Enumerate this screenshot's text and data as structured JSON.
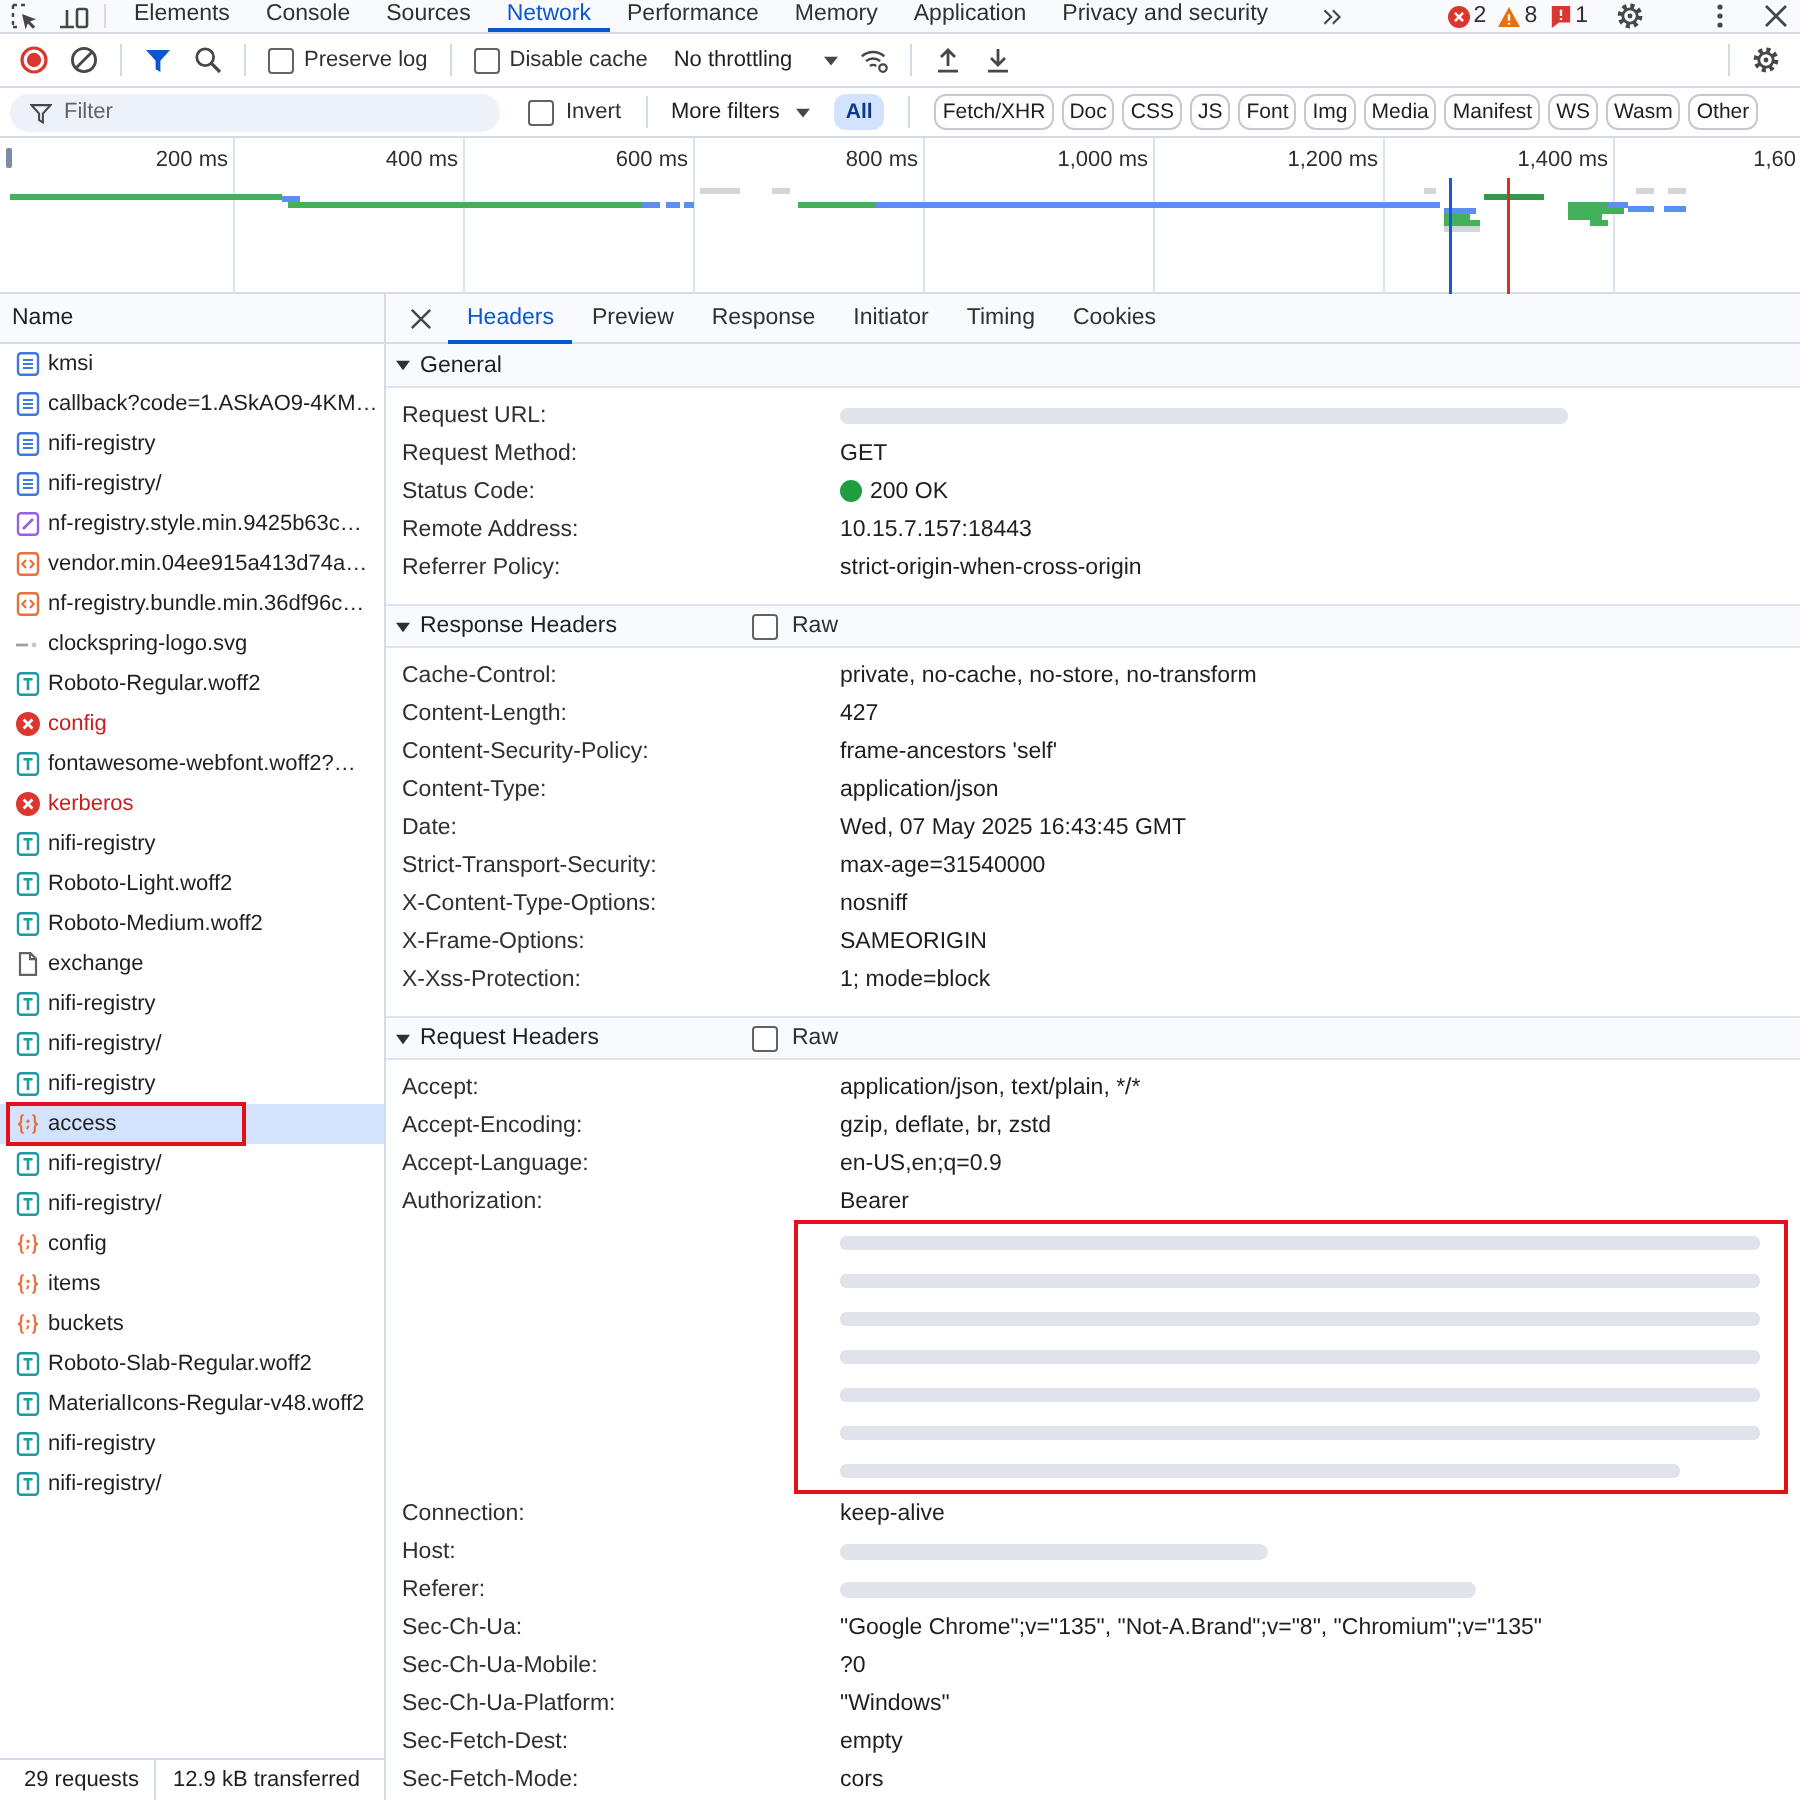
{
  "top_tabs": [
    {
      "label": "Elements",
      "selected": false
    },
    {
      "label": "Console",
      "selected": false
    },
    {
      "label": "Sources",
      "selected": false
    },
    {
      "label": "Network",
      "selected": true
    },
    {
      "label": "Performance",
      "selected": false
    },
    {
      "label": "Memory",
      "selected": false
    },
    {
      "label": "Application",
      "selected": false
    },
    {
      "label": "Privacy and security",
      "selected": false
    }
  ],
  "counters": [
    {
      "kind": "error",
      "count": "2"
    },
    {
      "kind": "warning",
      "count": "8"
    },
    {
      "kind": "issue",
      "count": "1"
    }
  ],
  "toolbar": {
    "recording": true,
    "filter_shown": true,
    "preserve_log": {
      "label": "Preserve log",
      "checked": false
    },
    "disable_cache": {
      "label": "Disable cache",
      "checked": false
    },
    "throttling": "No throttling"
  },
  "filter_bar": {
    "placeholder": "Filter",
    "invert": {
      "label": "Invert",
      "checked": false
    },
    "more_filters": "More filters",
    "types": [
      {
        "label": "All",
        "selected": true
      },
      {
        "label": "Fetch/XHR",
        "selected": false
      },
      {
        "label": "Doc",
        "selected": false
      },
      {
        "label": "CSS",
        "selected": false
      },
      {
        "label": "JS",
        "selected": false
      },
      {
        "label": "Font",
        "selected": false
      },
      {
        "label": "Img",
        "selected": false
      },
      {
        "label": "Media",
        "selected": false
      },
      {
        "label": "Manifest",
        "selected": false
      },
      {
        "label": "WS",
        "selected": false
      },
      {
        "label": "Wasm",
        "selected": false
      },
      {
        "label": "Other",
        "selected": false
      }
    ]
  },
  "overview": {
    "ticks": [
      "200 ms",
      "400 ms",
      "600 ms",
      "800 ms",
      "1,000 ms",
      "1,200 ms",
      "1,400 ms",
      "1,60"
    ]
  },
  "requests": {
    "column": "Name",
    "rows": [
      {
        "name": "kmsi",
        "kind": "document",
        "selected": false,
        "highlighted": false
      },
      {
        "name": "callback?code=1.ASkAO9-4KM…",
        "kind": "document",
        "selected": false,
        "highlighted": false
      },
      {
        "name": "nifi-registry",
        "kind": "document",
        "selected": false,
        "highlighted": false
      },
      {
        "name": "nifi-registry/",
        "kind": "document",
        "selected": false,
        "highlighted": false
      },
      {
        "name": "nf-registry.style.min.9425b63c…",
        "kind": "stylesheet",
        "selected": false,
        "highlighted": false
      },
      {
        "name": "vendor.min.04ee915a413d74a…",
        "kind": "script",
        "selected": false,
        "highlighted": false
      },
      {
        "name": "nf-registry.bundle.min.36df96c…",
        "kind": "script",
        "selected": false,
        "highlighted": false
      },
      {
        "name": "clockspring-logo.svg",
        "kind": "image",
        "selected": false,
        "highlighted": false
      },
      {
        "name": "Roboto-Regular.woff2",
        "kind": "font",
        "selected": false,
        "highlighted": false
      },
      {
        "name": "config",
        "kind": "failed",
        "selected": false,
        "highlighted": false
      },
      {
        "name": "fontawesome-webfont.woff2?…",
        "kind": "font",
        "selected": false,
        "highlighted": false
      },
      {
        "name": "kerberos",
        "kind": "failed",
        "selected": false,
        "highlighted": false
      },
      {
        "name": "nifi-registry",
        "kind": "font",
        "selected": false,
        "highlighted": false
      },
      {
        "name": "Roboto-Light.woff2",
        "kind": "font",
        "selected": false,
        "highlighted": false
      },
      {
        "name": "Roboto-Medium.woff2",
        "kind": "font",
        "selected": false,
        "highlighted": false
      },
      {
        "name": "exchange",
        "kind": "other",
        "selected": false,
        "highlighted": false
      },
      {
        "name": "nifi-registry",
        "kind": "font",
        "selected": false,
        "highlighted": false
      },
      {
        "name": "nifi-registry/",
        "kind": "font",
        "selected": false,
        "highlighted": false
      },
      {
        "name": "nifi-registry",
        "kind": "font",
        "selected": false,
        "highlighted": false
      },
      {
        "name": "access",
        "kind": "fetch",
        "selected": true,
        "highlighted": true
      },
      {
        "name": "nifi-registry/",
        "kind": "font",
        "selected": false,
        "highlighted": false
      },
      {
        "name": "nifi-registry/",
        "kind": "font",
        "selected": false,
        "highlighted": false
      },
      {
        "name": "config",
        "kind": "fetch",
        "selected": false,
        "highlighted": false
      },
      {
        "name": "items",
        "kind": "fetch",
        "selected": false,
        "highlighted": false
      },
      {
        "name": "buckets",
        "kind": "fetch",
        "selected": false,
        "highlighted": false
      },
      {
        "name": "Roboto-Slab-Regular.woff2",
        "kind": "font",
        "selected": false,
        "highlighted": false
      },
      {
        "name": "MaterialIcons-Regular-v48.woff2",
        "kind": "font",
        "selected": false,
        "highlighted": false
      },
      {
        "name": "nifi-registry",
        "kind": "font",
        "selected": false,
        "highlighted": false
      },
      {
        "name": "nifi-registry/",
        "kind": "font",
        "selected": false,
        "highlighted": false
      }
    ]
  },
  "status_bar": {
    "requests": "29 requests",
    "transferred": "12.9 kB transferred"
  },
  "details": {
    "tabs": [
      {
        "label": "Headers",
        "selected": true
      },
      {
        "label": "Preview",
        "selected": false
      },
      {
        "label": "Response",
        "selected": false
      },
      {
        "label": "Initiator",
        "selected": false
      },
      {
        "label": "Timing",
        "selected": false
      },
      {
        "label": "Cookies",
        "selected": false
      }
    ],
    "sections": [
      {
        "title": "General",
        "expanded": true,
        "rows": [
          {
            "name": "Request URL:",
            "kind": "redacted",
            "highlighted": false
          },
          {
            "name": "Request Method:",
            "value": "GET",
            "kind": "text",
            "highlighted": false
          },
          {
            "name": "Status Code:",
            "value": "200 OK",
            "kind": "status",
            "highlighted": false
          },
          {
            "name": "Remote Address:",
            "value": "10.15.7.157:18443",
            "kind": "text",
            "highlighted": false
          },
          {
            "name": "Referrer Policy:",
            "value": "strict-origin-when-cross-origin",
            "kind": "text",
            "highlighted": false
          }
        ]
      },
      {
        "title": "Response Headers",
        "expanded": true,
        "raw": {
          "label": "Raw",
          "checked": false
        },
        "rows": [
          {
            "name": "Cache-Control:",
            "value": "private, no-cache, no-store, no-transform",
            "kind": "text",
            "highlighted": false
          },
          {
            "name": "Content-Length:",
            "value": "427",
            "kind": "text",
            "highlighted": false
          },
          {
            "name": "Content-Security-Policy:",
            "value": "frame-ancestors 'self'",
            "kind": "text",
            "highlighted": false
          },
          {
            "name": "Content-Type:",
            "value": "application/json",
            "kind": "text",
            "highlighted": false
          },
          {
            "name": "Date:",
            "value": "Wed, 07 May 2025 16:43:45 GMT",
            "kind": "text",
            "highlighted": false
          },
          {
            "name": "Strict-Transport-Security:",
            "value": "max-age=31540000",
            "kind": "text",
            "highlighted": false
          },
          {
            "name": "X-Content-Type-Options:",
            "value": "nosniff",
            "kind": "text",
            "highlighted": false
          },
          {
            "name": "X-Frame-Options:",
            "value": "SAMEORIGIN",
            "kind": "text",
            "highlighted": false
          },
          {
            "name": "X-Xss-Protection:",
            "value": "1; mode=block",
            "kind": "text",
            "highlighted": false
          }
        ]
      },
      {
        "title": "Request Headers",
        "expanded": true,
        "raw": {
          "label": "Raw",
          "checked": false
        },
        "rows": [
          {
            "name": "Accept:",
            "value": "application/json, text/plain, */*",
            "kind": "text",
            "highlighted": false
          },
          {
            "name": "Accept-Encoding:",
            "value": "gzip, deflate, br, zstd",
            "kind": "text",
            "highlighted": false
          },
          {
            "name": "Accept-Language:",
            "value": "en-US,en;q=0.9",
            "kind": "text",
            "highlighted": false
          },
          {
            "name": "Authorization:",
            "value": "Bearer",
            "kind": "token",
            "highlighted": true
          },
          {
            "name": "Connection:",
            "value": "keep-alive",
            "kind": "text",
            "highlighted": false
          },
          {
            "name": "Host:",
            "kind": "redacted",
            "highlighted": false
          },
          {
            "name": "Referer:",
            "kind": "redacted",
            "highlighted": false
          },
          {
            "name": "Sec-Ch-Ua:",
            "value": "\"Google Chrome\";v=\"135\", \"Not-A.Brand\";v=\"8\", \"Chromium\";v=\"135\"",
            "kind": "text",
            "highlighted": false
          },
          {
            "name": "Sec-Ch-Ua-Mobile:",
            "value": "?0",
            "kind": "text",
            "highlighted": false
          },
          {
            "name": "Sec-Ch-Ua-Platform:",
            "value": "\"Windows\"",
            "kind": "text",
            "highlighted": false
          },
          {
            "name": "Sec-Fetch-Dest:",
            "value": "empty",
            "kind": "text",
            "highlighted": false
          },
          {
            "name": "Sec-Fetch-Mode:",
            "value": "cors",
            "kind": "text",
            "highlighted": false
          }
        ]
      }
    ]
  }
}
